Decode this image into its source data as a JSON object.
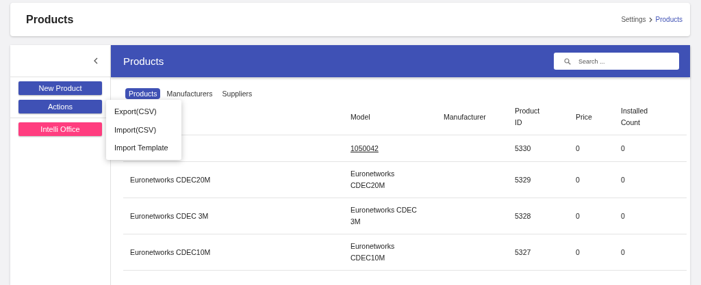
{
  "header": {
    "title": "Products",
    "breadcrumb": [
      {
        "label": "Settings",
        "current": false
      },
      {
        "label": "Products",
        "current": true
      }
    ]
  },
  "sidebar": {
    "buttons": [
      {
        "label": "New Product",
        "kind": "primary"
      },
      {
        "label": "Actions",
        "kind": "primary"
      },
      {
        "label": "Intelli Office",
        "kind": "accent"
      }
    ]
  },
  "panel": {
    "title": "Products",
    "search": {
      "placeholder": "Search ..."
    }
  },
  "tabs": [
    {
      "label": "Products",
      "selected": true
    },
    {
      "label": "Manufacturers",
      "selected": false
    },
    {
      "label": "Suppliers",
      "selected": false
    }
  ],
  "menu": {
    "items": [
      "Export(CSV)",
      "Import(CSV)",
      "Import Template"
    ]
  },
  "table": {
    "columns": [
      "Model",
      "Manufacturer",
      "Product ID",
      "Price",
      "Installed Count"
    ],
    "rows": [
      {
        "model": "1050042",
        "model_link": true,
        "product_id": "5330",
        "price": "0",
        "installed_count": "0"
      },
      {
        "name": "Euronetworks CDEC20M",
        "model": "Euronetworks CDEC20M",
        "model_link": false,
        "product_id": "5329",
        "price": "0",
        "installed_count": "0"
      },
      {
        "name": "Euronetworks CDEC 3M",
        "model": "Euronetworks CDEC 3M",
        "model_link": false,
        "product_id": "5328",
        "price": "0",
        "installed_count": "0"
      },
      {
        "name": "Euronetworks CDEC10M",
        "model": "Euronetworks CDEC10M",
        "model_link": false,
        "product_id": "5327",
        "price": "0",
        "installed_count": "0"
      }
    ]
  }
}
